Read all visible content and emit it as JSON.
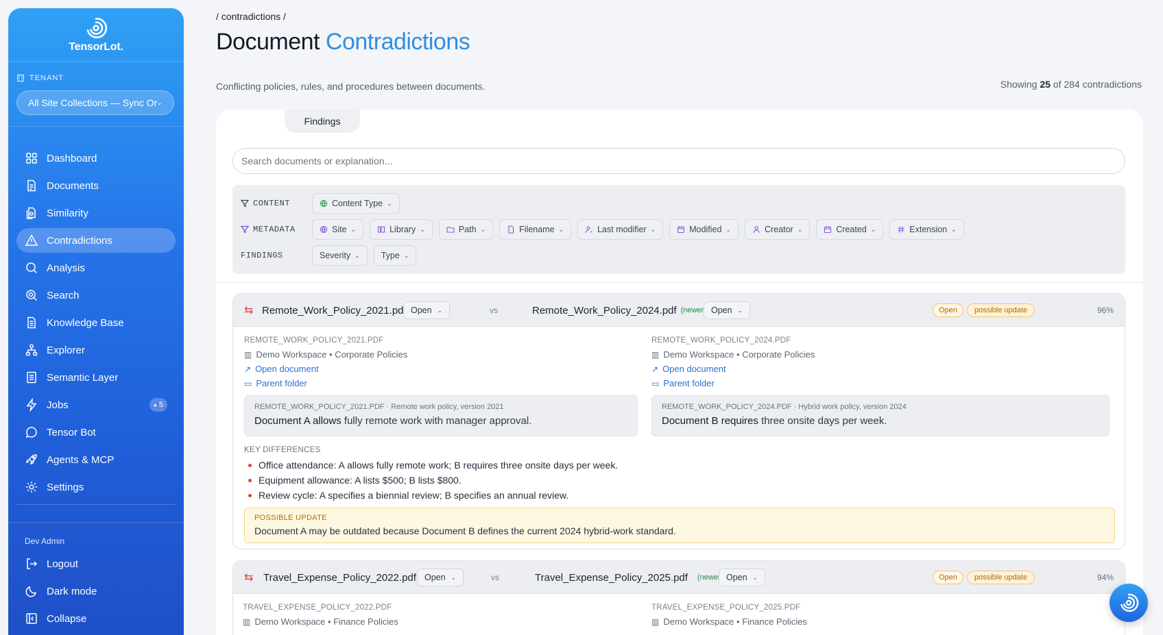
{
  "app": {
    "name": "TensorLot."
  },
  "sidebar": {
    "tenant_label": "TENANT",
    "tenant_value": "All Site Collections — Sync Or",
    "items": [
      {
        "label": "Dashboard",
        "icon": "grid-icon"
      },
      {
        "label": "Documents",
        "icon": "document-icon"
      },
      {
        "label": "Similarity",
        "icon": "copy-document-icon"
      },
      {
        "label": "Contradictions",
        "icon": "warning-triangle-icon",
        "active": true
      },
      {
        "label": "Analysis",
        "icon": "magnifier-icon"
      },
      {
        "label": "Search",
        "icon": "search-icon"
      },
      {
        "label": "Knowledge Base",
        "icon": "book-icon"
      },
      {
        "label": "Explorer",
        "icon": "hierarchy-icon"
      },
      {
        "label": "Semantic Layer",
        "icon": "list-document-icon"
      },
      {
        "label": "Jobs",
        "icon": "lightning-icon",
        "badge": "5"
      },
      {
        "label": "Tensor Bot",
        "icon": "chat-icon"
      },
      {
        "label": "Agents & MCP",
        "icon": "rocket-icon"
      },
      {
        "label": "Settings",
        "icon": "gear-icon"
      }
    ],
    "user_label": "Dev Admin",
    "bottom": [
      {
        "label": "Logout",
        "icon": "logout-icon"
      },
      {
        "label": "Dark mode",
        "icon": "moon-icon"
      },
      {
        "label": "Collapse",
        "icon": "collapse-icon"
      }
    ]
  },
  "header": {
    "breadcrumb": "/ contradictions /",
    "title_main": "Document",
    "title_accent": "Contradictions",
    "subtitle": "Conflicting policies, rules, and procedures between documents.",
    "showing_prefix": "Showing",
    "showing_count": "25",
    "showing_suffix": "of 284 contradictions"
  },
  "tabs": {
    "findings": "Findings"
  },
  "search": {
    "placeholder": "Search documents or explanation..."
  },
  "filters": {
    "content_label": "CONTENT",
    "content_chips": [
      "Content Type"
    ],
    "metadata_label": "METADATA",
    "metadata_chips": [
      "Site",
      "Library",
      "Path",
      "Filename",
      "Last modifier",
      "Modified",
      "Creator",
      "Created",
      "Extension"
    ],
    "findings_label": "FINDINGS",
    "findings_chips": [
      "Severity",
      "Type"
    ]
  },
  "findings": [
    {
      "doc_a": "Remote_Work_Policy_2021.pdf",
      "doc_a_status": "Open",
      "vs": "vs",
      "doc_b": "Remote_Work_Policy_2024.pdf",
      "doc_b_tag": "(newer)",
      "doc_b_status": "Open",
      "status_pill": "Open",
      "type_pill": "possible update",
      "score": "96%",
      "a": {
        "upper": "REMOTE_WORK_POLICY_2021.PDF",
        "workspace": "Demo Workspace • Corporate Policies",
        "open_link": "Open document",
        "folder_link": "Parent folder",
        "excerpt_meta": "REMOTE_WORK_POLICY_2021.PDF · Remote work policy, version 2021",
        "excerpt_bold": "Document A allows",
        "excerpt_rest": " fully remote work with manager approval."
      },
      "b": {
        "upper": "REMOTE_WORK_POLICY_2024.PDF",
        "workspace": "Demo Workspace • Corporate Policies",
        "open_link": "Open document",
        "folder_link": "Parent folder",
        "excerpt_meta": "REMOTE_WORK_POLICY_2024.PDF · Hybrid work policy, version 2024",
        "excerpt_bold": "Document B requires",
        "excerpt_rest": " three onsite days per week."
      },
      "key_diff_label": "KEY DIFFERENCES",
      "key_diffs": [
        "Office attendance:  A allows fully remote work; B requires three onsite days per week.",
        "Equipment allowance:  A lists $500; B lists $800.",
        "Review cycle:  A specifies a biennial review; B specifies an annual review."
      ],
      "update_label": "POSSIBLE UPDATE",
      "update_text": "Document A may be outdated because Document B defines the current 2024 hybrid-work standard."
    },
    {
      "doc_a": "Travel_Expense_Policy_2022.pdf",
      "doc_a_status": "Open",
      "vs": "vs",
      "doc_b": "Travel_Expense_Policy_2025.pdf",
      "doc_b_tag": "(newer)",
      "doc_b_status": "Open",
      "status_pill": "Open",
      "type_pill": "possible update",
      "score": "94%",
      "a": {
        "upper": "TRAVEL_EXPENSE_POLICY_2022.PDF",
        "workspace": "Demo Workspace • Finance Policies"
      },
      "b": {
        "upper": "TRAVEL_EXPENSE_POLICY_2025.PDF",
        "workspace": "Demo Workspace • Finance Policies"
      }
    }
  ],
  "colors": {
    "accent": "#2e8fe0",
    "sidebar_top": "#2fa1f4",
    "sidebar_bottom": "#1e52cc",
    "danger": "#d9443a",
    "warning": "#b46a05"
  }
}
